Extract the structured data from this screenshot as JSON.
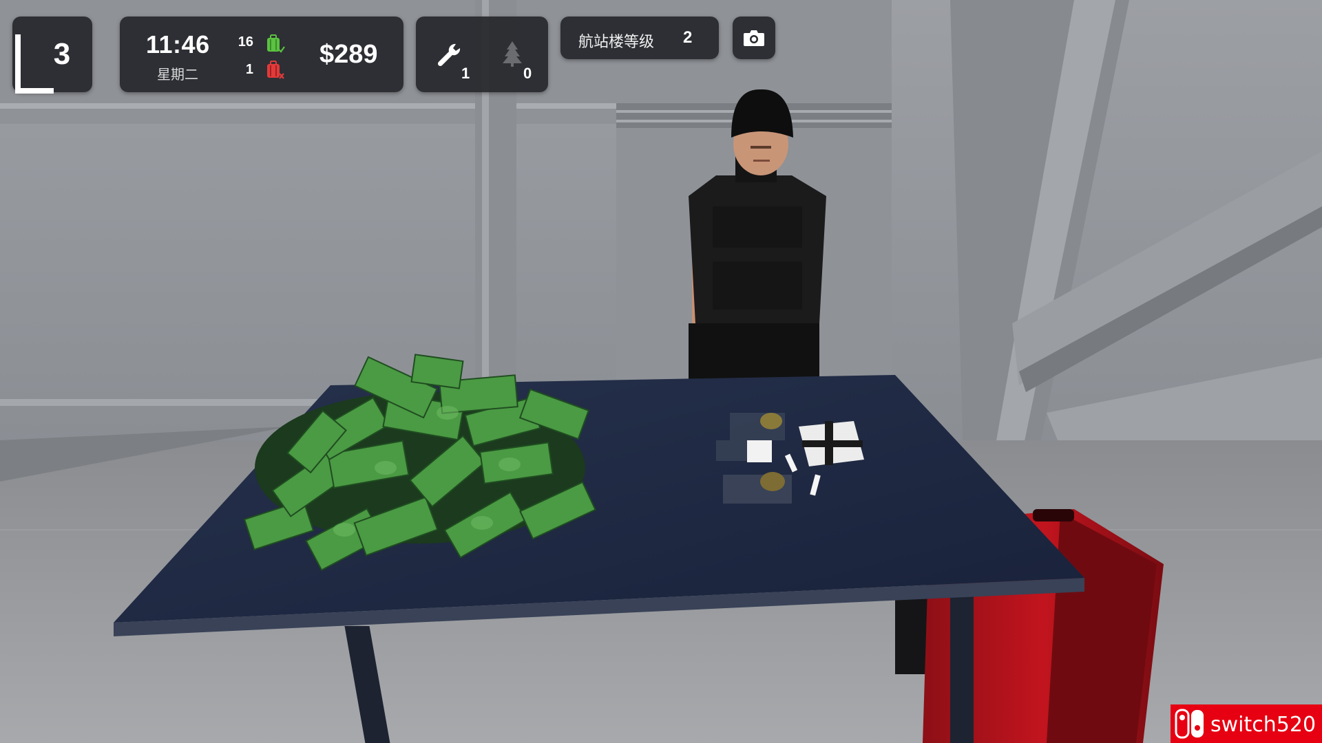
{
  "hud": {
    "level": "3",
    "time": "11:46",
    "weekday": "星期二",
    "bags_passed": "16",
    "bags_rejected": "1",
    "money": "$289",
    "wrench_count": "1",
    "tree_count": "0",
    "terminal_label": "航站楼等级",
    "terminal_level": "2",
    "icons": {
      "bag_passed": "suitcase-check-icon",
      "bag_rejected": "suitcase-x-icon",
      "wrench": "wrench-icon",
      "tree": "tree-icon",
      "camera": "camera-icon"
    }
  },
  "colors": {
    "hud_bg": "#26282c",
    "bag_ok": "#5cc242",
    "bag_bad": "#e23a3a",
    "cash_green": "#3f8f3a",
    "table_top": "#1e2840",
    "suitcase_red": "#b3121b"
  },
  "watermark": {
    "text": "switch520"
  }
}
